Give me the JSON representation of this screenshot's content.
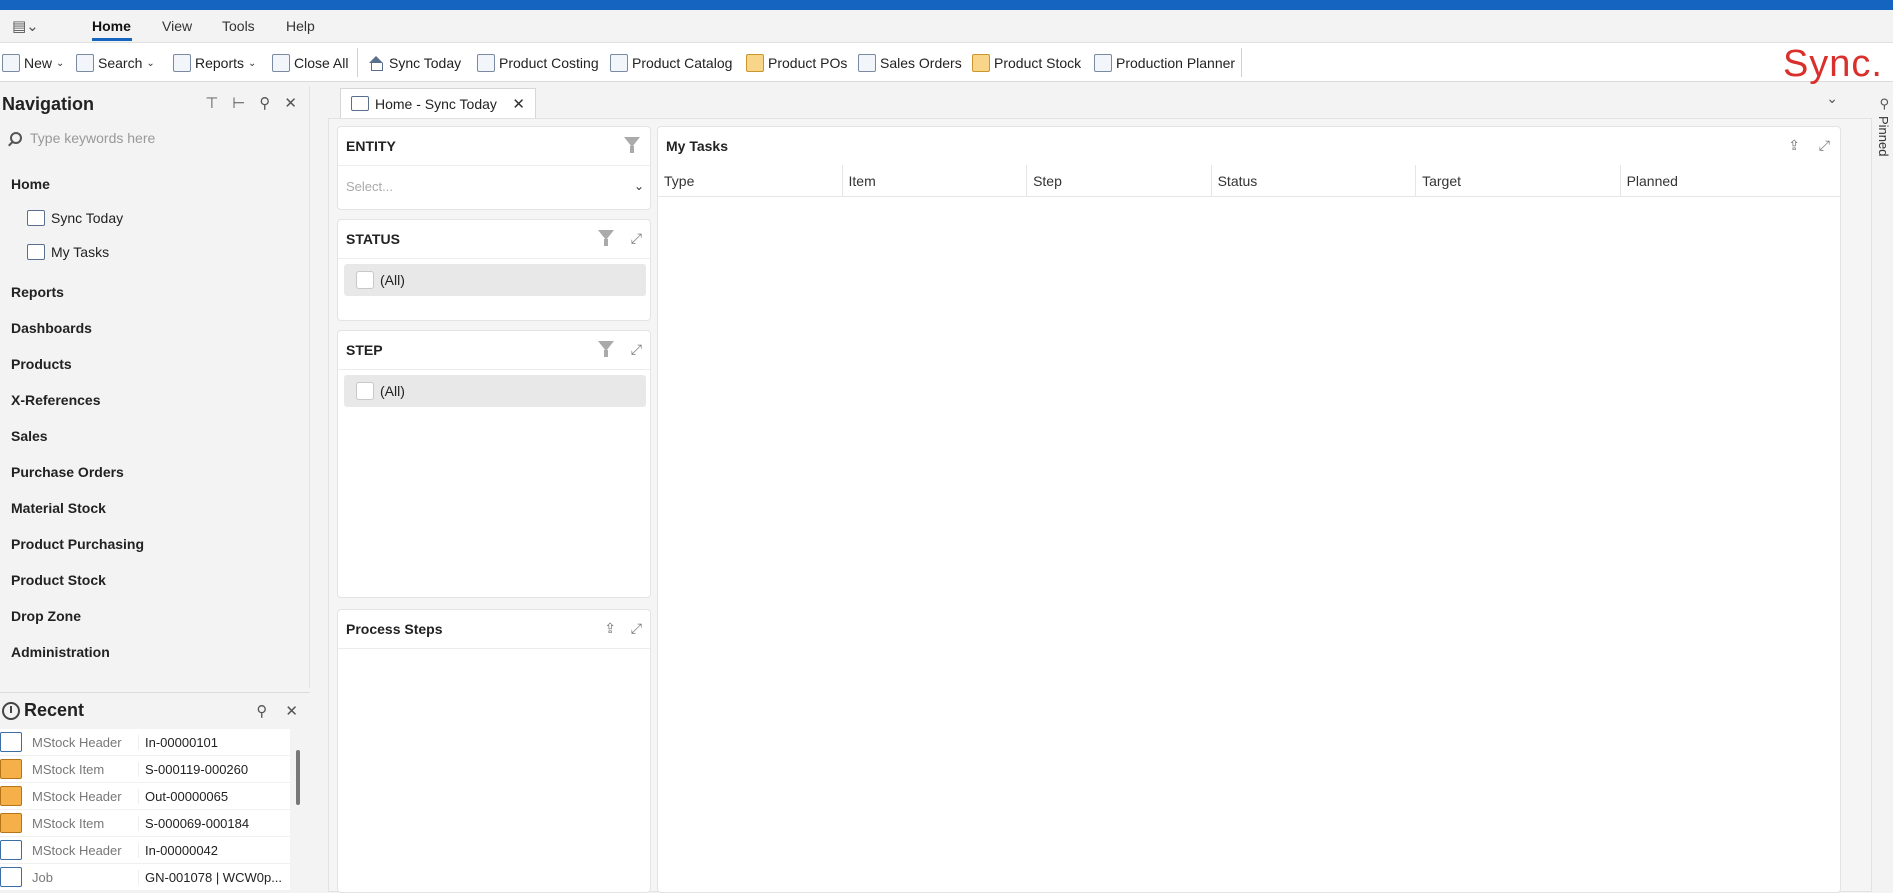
{
  "menu": {
    "items": [
      "Home",
      "View",
      "Tools",
      "Help"
    ],
    "active": "Home"
  },
  "toolbar": {
    "new": "New",
    "search": "Search",
    "reports": "Reports",
    "close_all": "Close All",
    "sync_today": "Sync Today",
    "product_costing": "Product Costing",
    "product_catalog": "Product Catalog",
    "product_pos": "Product POs",
    "sales_orders": "Sales Orders",
    "product_stock": "Product Stock",
    "production_planner": "Production Planner",
    "logo": "Sync.",
    "accent_color": "#1565c0",
    "logo_color": "#d9302b"
  },
  "navigation": {
    "title": "Navigation",
    "search_placeholder": "Type keywords here",
    "home": "Home",
    "home_items": [
      "Sync Today",
      "My Tasks"
    ],
    "groups": [
      "Reports",
      "Dashboards",
      "Products",
      "X-References",
      "Sales",
      "Purchase Orders",
      "Material Stock",
      "Product Purchasing",
      "Product Stock",
      "Drop Zone",
      "Administration"
    ]
  },
  "recent": {
    "title": "Recent",
    "rows": [
      {
        "icon": "stock-in-icon",
        "type": "MStock Header",
        "value": "In-00000101"
      },
      {
        "icon": "stock-item-icon",
        "type": "MStock Item",
        "value": "S-000119-000260"
      },
      {
        "icon": "stock-out-icon",
        "type": "MStock Header",
        "value": "Out-00000065"
      },
      {
        "icon": "stock-item-icon",
        "type": "MStock Item",
        "value": "S-000069-000184"
      },
      {
        "icon": "stock-in-icon",
        "type": "MStock Header",
        "value": "In-00000042"
      },
      {
        "icon": "job-icon",
        "type": "Job",
        "value": "GN-001078 | WCW0p..."
      }
    ]
  },
  "tab": {
    "label": "Home - Sync Today"
  },
  "entity": {
    "title": "ENTITY",
    "placeholder": "Select..."
  },
  "status": {
    "title": "STATUS",
    "option": "(All)"
  },
  "step": {
    "title": "STEP",
    "option": "(All)"
  },
  "process_steps": {
    "title": "Process Steps"
  },
  "my_tasks": {
    "title": "My Tasks",
    "columns": [
      "Type",
      "Item",
      "Step",
      "Status",
      "Target",
      "Planned"
    ]
  },
  "side": {
    "pinned": "Pinned"
  }
}
